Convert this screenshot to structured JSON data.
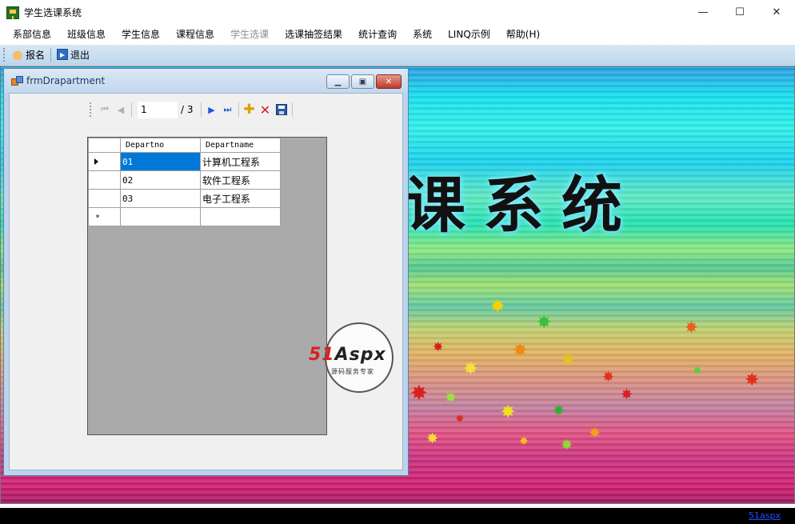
{
  "window": {
    "title": "学生选课系统",
    "min": "—",
    "max": "☐",
    "close": "✕"
  },
  "menu": [
    {
      "label": "系部信息",
      "disabled": false
    },
    {
      "label": "班级信息",
      "disabled": false
    },
    {
      "label": "学生信息",
      "disabled": false
    },
    {
      "label": "课程信息",
      "disabled": false
    },
    {
      "label": "学生选课",
      "disabled": true
    },
    {
      "label": "选课抽签结果",
      "disabled": false
    },
    {
      "label": "统计查询",
      "disabled": false
    },
    {
      "label": "系统",
      "disabled": false
    },
    {
      "label": "LINQ示例",
      "disabled": false
    },
    {
      "label": "帮助(H)",
      "disabled": false
    }
  ],
  "toolbar": {
    "enroll": "报名",
    "exit": "退出"
  },
  "background": {
    "banner": "课系统"
  },
  "child": {
    "title": "frmDrapartment",
    "nav": {
      "position": "1",
      "count": "/ 3"
    },
    "grid": {
      "columns": [
        "Departno",
        "Departname"
      ],
      "rows": [
        {
          "no": "01",
          "name": "计算机工程系"
        },
        {
          "no": "02",
          "name": "软件工程系"
        },
        {
          "no": "03",
          "name": "电子工程系"
        }
      ],
      "new_row_marker": "*"
    }
  },
  "watermark": {
    "brand_51": "51",
    "brand_aspx": "Aspx",
    "sub": "源码服务专家"
  },
  "status": {
    "link": "51aspx"
  },
  "colors": {
    "selection": "#0078d7",
    "toolbar": "#c9def0",
    "status_bar": "#000000"
  }
}
